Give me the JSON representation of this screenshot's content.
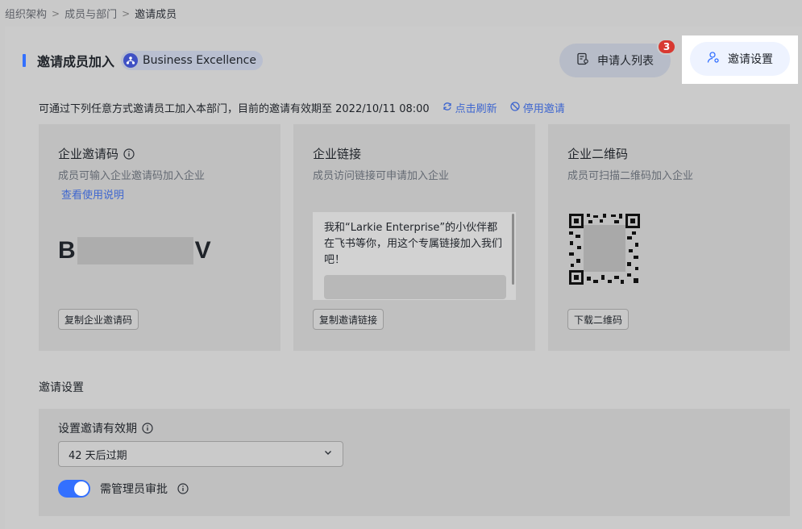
{
  "breadcrumb": {
    "items": [
      "组织架构",
      "成员与部门"
    ],
    "current": "邀请成员"
  },
  "header": {
    "title": "邀请成员加入",
    "org_name": "Business Excellence",
    "applicants_label": "申请人列表",
    "applicants_count": "3",
    "settings_label": "邀请设置"
  },
  "description": {
    "text": "可通过下列任意方式邀请员工加入本部门，目前的邀请有效期至 2022/10/11 08:00",
    "refresh_label": "点击刷新",
    "disable_label": "停用邀请"
  },
  "cards": {
    "code": {
      "title": "企业邀请码",
      "subtitle": "成员可输入企业邀请码加入企业",
      "help_link": "查看使用说明",
      "code_start": "B",
      "code_end": "V",
      "button": "复制企业邀请码"
    },
    "link": {
      "title": "企业链接",
      "subtitle": "成员访问链接可申请加入企业",
      "message": "我和“Larkie Enterprise”的小伙伴都在飞书等你，用这个专属链接加入我们吧！",
      "button": "复制邀请链接"
    },
    "qr": {
      "title": "企业二维码",
      "subtitle": "成员可扫描二维码加入企业",
      "button": "下载二维码"
    }
  },
  "settings": {
    "section_label": "邀请设置",
    "validity_label": "设置邀请有效期",
    "validity_value": "42 天后过期",
    "approval_label": "需管理员审批",
    "approval_enabled": true
  },
  "colors": {
    "accent": "#3370ff",
    "badge": "#d83931",
    "link": "#3e66cf"
  }
}
